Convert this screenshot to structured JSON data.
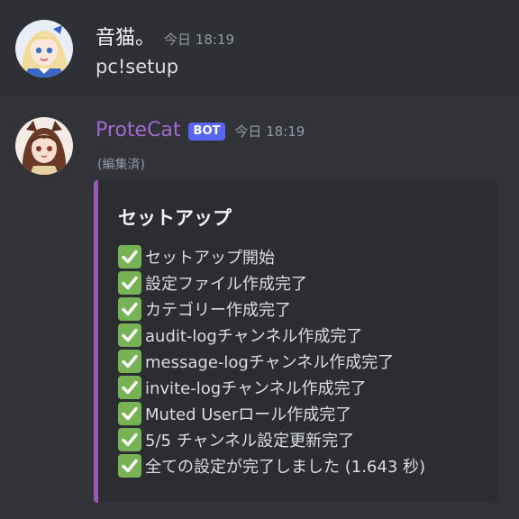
{
  "messages": [
    {
      "username": "音猫。",
      "timestamp": "今日 18:19",
      "text": "pc!setup",
      "is_bot": false
    },
    {
      "username": "ProteCat",
      "bot_tag": "BOT",
      "timestamp": "今日 18:19",
      "edited": "(編集済)",
      "is_bot": true,
      "embed": {
        "accent_color": "#9b59b6",
        "title": "セットアップ",
        "steps": [
          "セットアップ開始",
          "設定ファイル作成完了",
          "カテゴリー作成完了",
          "audit-logチャンネル作成完了",
          "message-logチャンネル作成完了",
          "invite-logチャンネル作成完了",
          "Muted Userロール作成完了",
          "5/5 チャンネル設定更新完了",
          "全ての設定が完了しました (1.643 秒)"
        ]
      }
    }
  ],
  "colors": {
    "background": "#313338",
    "bot_username": "#a36bd1",
    "bot_tag": "#5865f2",
    "check": "#77b255"
  },
  "icons": {
    "step_icon": "white-check-mark-icon"
  }
}
